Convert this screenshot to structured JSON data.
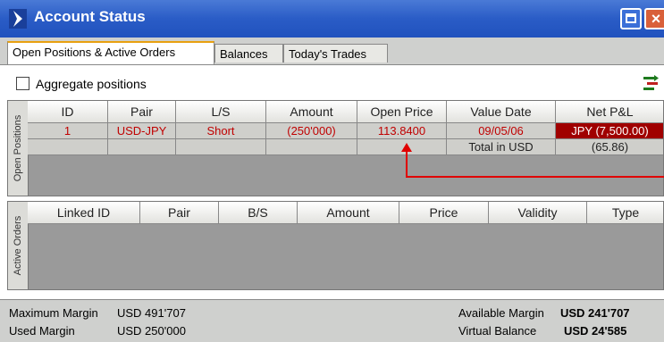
{
  "window": {
    "title": "Account Status"
  },
  "tabs": [
    "Open Positions & Active Orders",
    "Balances",
    "Today's Trades"
  ],
  "aggregate": {
    "label": "Aggregate positions",
    "checked": false
  },
  "open_positions": {
    "side_label": "Open Positions",
    "headers": [
      "ID",
      "Pair",
      "L/S",
      "Amount",
      "Open Price",
      "Value Date",
      "Net P&L"
    ],
    "rows": [
      [
        "1",
        "USD-JPY",
        "Short",
        "(250'000)",
        "113.8400",
        "09/05/06",
        "JPY (7,500.00)"
      ]
    ],
    "total_label": "Total in USD",
    "total_value": "(65.86)"
  },
  "active_orders": {
    "side_label": "Active Orders",
    "headers": [
      "Linked ID",
      "Pair",
      "B/S",
      "Amount",
      "Price",
      "Validity",
      "Type"
    ]
  },
  "footer": {
    "max_margin_label": "Maximum Margin",
    "max_margin_value": "USD 491'707",
    "used_margin_label": "Used Margin",
    "used_margin_value": "USD 250'000",
    "available_margin_label": "Available Margin",
    "available_margin_value": "USD 241'707",
    "virtual_balance_label": "Virtual Balance",
    "virtual_balance_value": "USD 24'585"
  },
  "colors": {
    "titlebar": "#2a5cc6",
    "loss_text": "#c00000",
    "pnl_bg": "#a00000",
    "annotation": "#e00000"
  },
  "icons": [
    "app-logo-icon",
    "maximize-icon",
    "close-icon",
    "aggregate-settings-icon"
  ]
}
